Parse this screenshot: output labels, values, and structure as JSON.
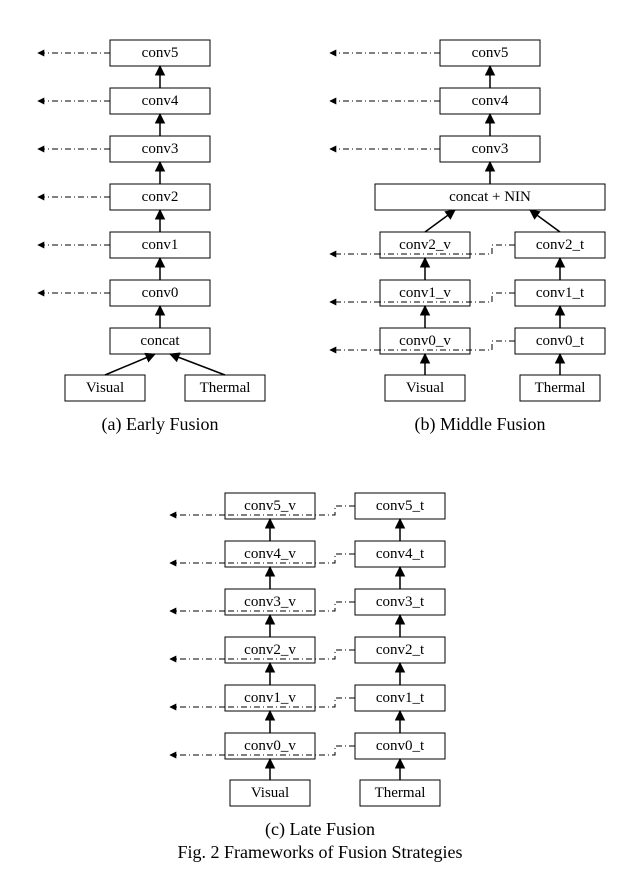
{
  "figure_caption": "Fig. 2 Frameworks of Fusion Strategies",
  "panels": {
    "a": {
      "caption": "(a) Early Fusion",
      "inputs": {
        "visual": "Visual",
        "thermal": "Thermal"
      },
      "layers": [
        "concat",
        "conv0",
        "conv1",
        "conv2",
        "conv3",
        "conv4",
        "conv5"
      ]
    },
    "b": {
      "caption": "(b) Middle Fusion",
      "inputs": {
        "visual": "Visual",
        "thermal": "Thermal"
      },
      "visual_layers": [
        "conv0_v",
        "conv1_v",
        "conv2_v"
      ],
      "thermal_layers": [
        "conv0_t",
        "conv1_t",
        "conv2_t"
      ],
      "fusion": "concat + NIN",
      "shared_layers": [
        "conv3",
        "conv4",
        "conv5"
      ]
    },
    "c": {
      "caption": "(c) Late Fusion",
      "inputs": {
        "visual": "Visual",
        "thermal": "Thermal"
      },
      "visual_layers": [
        "conv0_v",
        "conv1_v",
        "conv2_v",
        "conv3_v",
        "conv4_v",
        "conv5_v"
      ],
      "thermal_layers": [
        "conv0_t",
        "conv1_t",
        "conv2_t",
        "conv3_t",
        "conv4_t",
        "conv5_t"
      ]
    }
  }
}
